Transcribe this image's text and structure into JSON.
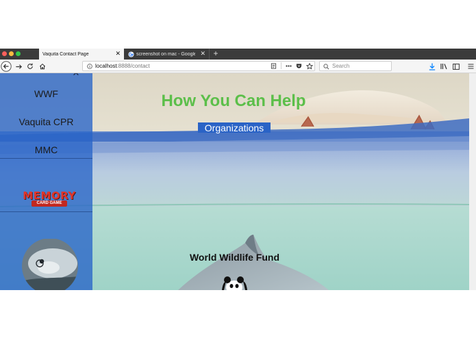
{
  "browser": {
    "tabs": [
      {
        "label": "Vaquita Contact Page",
        "close": "✕",
        "active": true
      },
      {
        "label": "screenshot on mac - Google Se",
        "close": "✕",
        "active": false
      }
    ],
    "new_tab": "+",
    "url_host": "localhost",
    "url_rest": ":8888/contact",
    "search_placeholder": "Search"
  },
  "sidebar": {
    "close_glyph": "✕",
    "links": [
      "WWF",
      "Vaquita CPR",
      "MMC"
    ],
    "logo": {
      "line1": "MEMORY",
      "line2": "CARD GAME"
    }
  },
  "main": {
    "heading": "How You Can Help",
    "badge": "Organizations",
    "fund_title": "World Wildlife Fund"
  },
  "colors": {
    "heading": "#5cbf4a",
    "sidebar": "#2864c8",
    "badge": "#2a63c6"
  }
}
